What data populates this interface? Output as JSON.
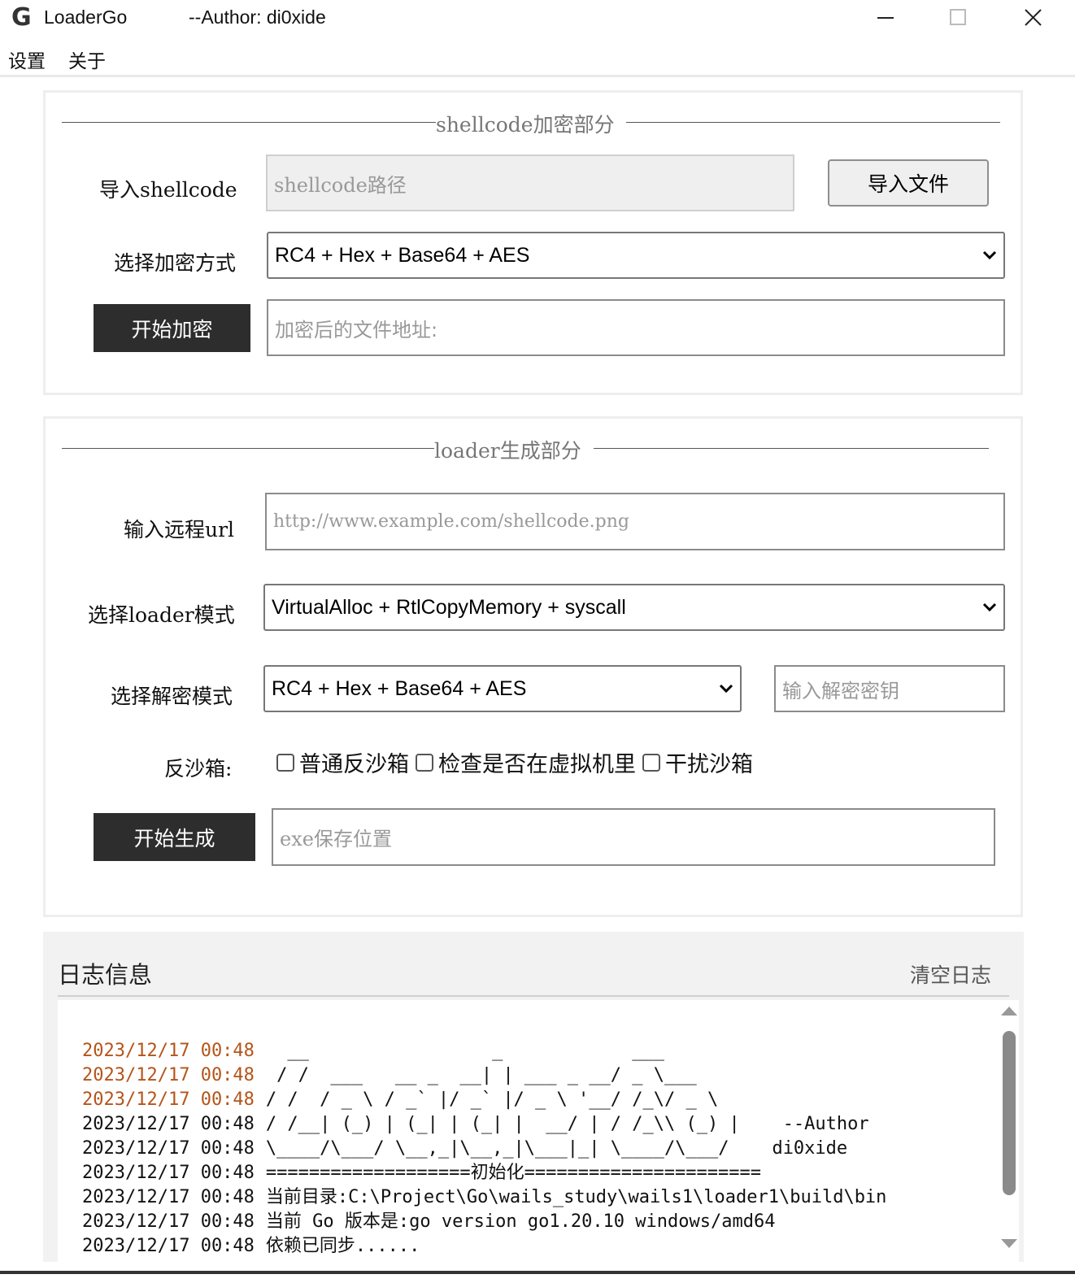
{
  "window": {
    "title": "LoaderGo",
    "author": "--Author: di0xide",
    "icon": "G"
  },
  "menu": {
    "items": [
      "设置",
      "关于"
    ]
  },
  "encrypt_section": {
    "legend": "shellcode加密部分",
    "shellcode_label": "导入shellcode",
    "shellcode_placeholder": "shellcode路径",
    "import_button": "导入文件",
    "method_label": "选择加密方式",
    "method_value": "RC4 + Hex + Base64 + AES",
    "start_button": "开始加密",
    "output_placeholder": "加密后的文件地址:"
  },
  "loader_section": {
    "legend": "loader生成部分",
    "url_label": "输入远程url",
    "url_placeholder": "http://www.example.com/shellcode.png",
    "mode_label": "选择loader模式",
    "mode_value": "VirtualAlloc + RtlCopyMemory + syscall",
    "decrypt_label": "选择解密模式",
    "decrypt_value": "RC4 + Hex + Base64 + AES",
    "key_placeholder": "输入解密密钥",
    "sandbox_label": "反沙箱:",
    "sandbox_options": [
      "普通反沙箱",
      "检查是否在虚拟机里",
      "干扰沙箱"
    ],
    "start_button": "开始生成",
    "exe_placeholder": "exe保存位置"
  },
  "log": {
    "title": "日志信息",
    "clear_button": "清空日志",
    "timestamp_color_highlight": "#b5541a",
    "lines": [
      {
        "ts": "2023/12/17 00:48",
        "text": "  __                 _            ___        "
      },
      {
        "ts": "2023/12/17 00:48",
        "text": " / /  ___   __ _  __| | ___ _ __/ _ \\___    "
      },
      {
        "ts": "2023/12/17 00:48",
        "text": "/ /  / _ \\ / _` |/ _` |/ _ \\ '__/ /_\\/ _ \\"
      },
      {
        "ts": "2023/12/17 00:48",
        "text": "/ /__| (_) | (_| | (_| |  __/ | / /_\\\\ (_) |    --Author"
      },
      {
        "ts": "2023/12/17 00:48",
        "text": "\\____/\\___/ \\__,_|\\__,_|\\___|_| \\____/\\___/    di0xide"
      },
      {
        "ts": "2023/12/17 00:48",
        "text": "===================初始化======================"
      },
      {
        "ts": "2023/12/17 00:48",
        "text": "当前目录:C:\\Project\\Go\\wails_study\\wails1\\loader1\\build\\bin"
      },
      {
        "ts": "2023/12/17 00:48",
        "text": "当前 Go 版本是:go version go1.20.10 windows/amd64"
      },
      {
        "ts": "2023/12/17 00:48",
        "text": "依赖已同步......"
      }
    ]
  }
}
